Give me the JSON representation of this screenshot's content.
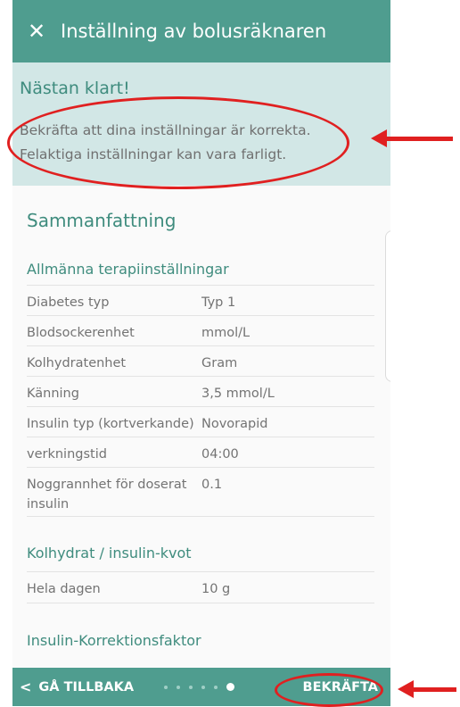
{
  "header": {
    "close_icon": "close-icon",
    "title": "Inställning av bolusräknaren"
  },
  "notice": {
    "title": "Nästan klart!",
    "line1": "Bekräfta att dina inställningar är korrekta.",
    "line2": "Felaktiga inställningar kan vara farligt."
  },
  "summary": {
    "title": "Sammanfattning",
    "general": {
      "title": "Allmänna terapiinställningar",
      "rows": [
        {
          "label": "Diabetes typ",
          "value": "Typ 1"
        },
        {
          "label": "Blodsockerenhet",
          "value": "mmol/L"
        },
        {
          "label": "Kolhydratenhet",
          "value": "Gram"
        },
        {
          "label": "Känning",
          "value": "3,5 mmol/L"
        },
        {
          "label": "Insulin typ (kortverkande)",
          "value": "Novorapid"
        },
        {
          "label": "verkningstid",
          "value": "04:00"
        },
        {
          "label": "Noggrannhet för doserat insulin",
          "value": "0.1"
        }
      ]
    },
    "carb_ratio": {
      "title": "Kolhydrat / insulin-kvot",
      "rows": [
        {
          "label": "Hela dagen",
          "value": "10 g"
        }
      ]
    },
    "correction": {
      "title": "Insulin-Korrektionsfaktor"
    }
  },
  "footer": {
    "back_label": "GÅ TILLBAKA",
    "back_icon": "chevron-left-icon",
    "confirm_label": "BEKRÄFTA",
    "steps_total": 6,
    "current_step": 6
  },
  "colors": {
    "primary": "#4f9d8f",
    "notice_bg": "#d2e7e6",
    "heading": "#3f8c7e",
    "annotation": "#e02020"
  }
}
